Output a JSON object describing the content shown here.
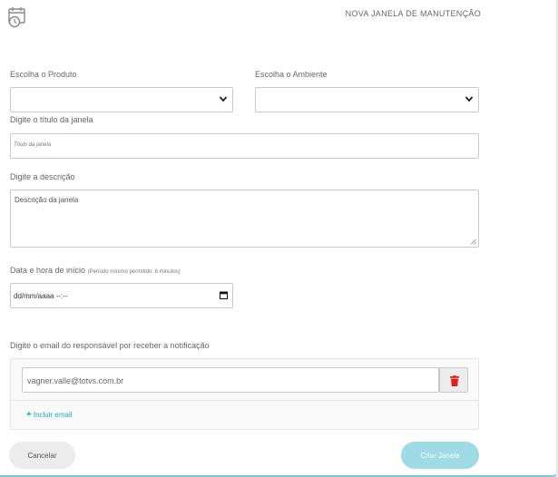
{
  "header": {
    "title": "NOVA JANELA DE MANUTENÇÃO",
    "icon": "calendar-clock-icon"
  },
  "form": {
    "product_label": "Escolha o Produto",
    "product_value": "",
    "environment_label": "Escolha o Ambiente",
    "environment_value": "",
    "title_label": "Digite o título da janela",
    "title_placeholder": "Título da janela",
    "description_label": "Digite a descrição",
    "description_placeholder": "Descrição da janela",
    "start_label": "Data e hora de início",
    "start_hint": "(Período mínimo permitido: 6 minutos)",
    "start_value": "dd/mm/aaaa --:--",
    "email_label": "Digite o email do responsável por receber a notificação",
    "emails": [
      "vagner.valle@totvs.com.br"
    ],
    "add_email_label": "Incluir email"
  },
  "actions": {
    "cancel_label": "Cancelar",
    "create_label": "Criar Janela"
  },
  "colors": {
    "accent": "#23a6bd",
    "create_button": "#9fdbe6",
    "delete_icon": "#e02020"
  }
}
